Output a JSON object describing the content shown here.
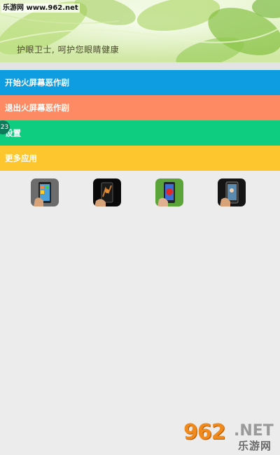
{
  "watermark_top": "乐游网 www.962.net",
  "banner": {
    "caption": "护眼卫士, 呵护您眼睛健康"
  },
  "menu": [
    {
      "label": "开始火屏幕恶作剧",
      "color": "#0f9de1"
    },
    {
      "label": "退出火屏幕恶作剧",
      "color": "#fd8a62"
    },
    {
      "label": "设置",
      "color": "#0fcd80"
    },
    {
      "label": "更多应用",
      "color": "#fec62e"
    }
  ],
  "badge": "23",
  "more_apps": [
    {
      "icon": "phone-app-icon"
    },
    {
      "icon": "phone-app-icon"
    },
    {
      "icon": "phone-app-icon"
    },
    {
      "icon": "phone-app-icon"
    }
  ],
  "watermark_bottom": {
    "number": "962",
    "domain": ".NET",
    "cn": "乐游网"
  }
}
